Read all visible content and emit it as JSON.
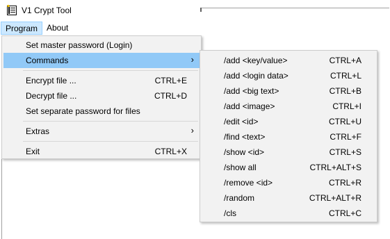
{
  "window": {
    "title": "V1 Crypt Tool",
    "icon": "notebook-icon"
  },
  "menubar": {
    "program": "Program",
    "about": "About"
  },
  "program_menu": {
    "items": [
      {
        "label": "Set master password (Login)",
        "shortcut": ""
      },
      {
        "label": "Commands",
        "shortcut": "",
        "submenu": true
      },
      {
        "label": "Encrypt file ...",
        "shortcut": "CTRL+E"
      },
      {
        "label": "Decrypt file ...",
        "shortcut": "CTRL+D"
      },
      {
        "label": "Set separate password for files",
        "shortcut": ""
      },
      {
        "label": "Extras",
        "shortcut": "",
        "submenu": true
      },
      {
        "label": "Exit",
        "shortcut": "CTRL+X"
      }
    ]
  },
  "commands_menu": {
    "items": [
      {
        "label": "/add <key/value>",
        "shortcut": "CTRL+A"
      },
      {
        "label": "/add <login data>",
        "shortcut": "CTRL+L"
      },
      {
        "label": "/add <big text>",
        "shortcut": "CTRL+B"
      },
      {
        "label": "/add <image>",
        "shortcut": "CTRL+I"
      },
      {
        "label": "/edit <id>",
        "shortcut": "CTRL+U"
      },
      {
        "label": "/find <text>",
        "shortcut": "CTRL+F"
      },
      {
        "label": "/show <id>",
        "shortcut": "CTRL+S"
      },
      {
        "label": "/show all",
        "shortcut": "CTRL+ALT+S"
      },
      {
        "label": "/remove <id>",
        "shortcut": "CTRL+R"
      },
      {
        "label": "/random",
        "shortcut": "CTRL+ALT+R"
      },
      {
        "label": "/cls",
        "shortcut": "CTRL+C"
      }
    ]
  },
  "colors": {
    "menu_bg": "#f2f2f2",
    "highlight": "#91c9f7",
    "menubar_active": "#cce8ff"
  }
}
